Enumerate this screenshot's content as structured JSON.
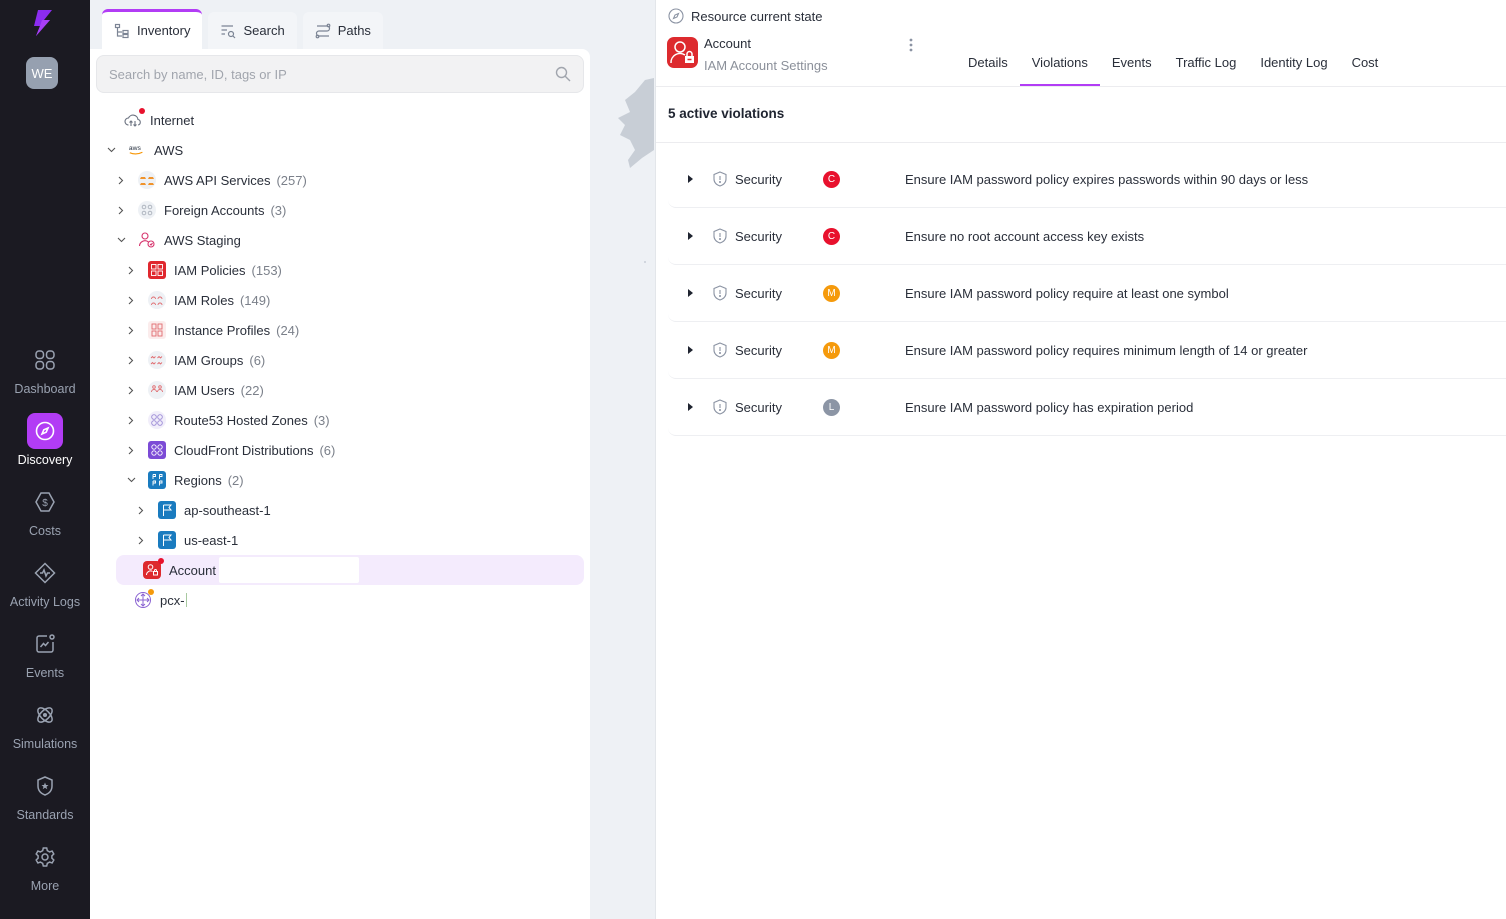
{
  "nav": {
    "avatar_initials": "WE",
    "items": [
      {
        "label": "Dashboard",
        "icon": "grid-icon",
        "active": false
      },
      {
        "label": "Discovery",
        "icon": "compass-icon",
        "active": true
      },
      {
        "label": "Costs",
        "icon": "dollar-hexagon-icon",
        "active": false
      },
      {
        "label": "Activity Logs",
        "icon": "activity-icon",
        "active": false
      },
      {
        "label": "Events",
        "icon": "chart-notification-icon",
        "active": false
      },
      {
        "label": "Simulations",
        "icon": "atom-icon",
        "active": false
      },
      {
        "label": "Standards",
        "icon": "shield-star-icon",
        "active": false
      },
      {
        "label": "More",
        "icon": "gear-icon",
        "active": false
      }
    ],
    "accent": "#b23cf5"
  },
  "inventory": {
    "tabs": [
      {
        "label": "Inventory",
        "icon": "hierarchy-icon",
        "active": true
      },
      {
        "label": "Search",
        "icon": "search-list-icon",
        "active": false
      },
      {
        "label": "Paths",
        "icon": "paths-icon",
        "active": false
      }
    ],
    "search_placeholder": "Search by name, ID, tags or IP",
    "tree": [
      {
        "label": "Internet",
        "count": "",
        "icon": "cloud-internet-icon"
      },
      {
        "label": "AWS",
        "count": "",
        "icon": "aws-logo-icon"
      },
      {
        "label": "AWS API Services",
        "count": "(257)",
        "icon": "api-services-icon"
      },
      {
        "label": "Foreign Accounts",
        "count": "(3)",
        "icon": "foreign-accounts-icon"
      },
      {
        "label": "AWS Staging",
        "count": "",
        "icon": "account-icon"
      },
      {
        "label": "IAM Policies",
        "count": "(153)",
        "icon": "iam-policies-icon"
      },
      {
        "label": "IAM Roles",
        "count": "(149)",
        "icon": "iam-roles-icon"
      },
      {
        "label": "Instance Profiles",
        "count": "(24)",
        "icon": "instance-profiles-icon"
      },
      {
        "label": "IAM Groups",
        "count": "(6)",
        "icon": "iam-groups-icon"
      },
      {
        "label": "IAM Users",
        "count": "(22)",
        "icon": "iam-users-icon"
      },
      {
        "label": "Route53 Hosted Zones",
        "count": "(3)",
        "icon": "route53-icon"
      },
      {
        "label": "CloudFront Distributions",
        "count": "(6)",
        "icon": "cloudfront-icon"
      },
      {
        "label": "Regions",
        "count": "(2)",
        "icon": "regions-icon"
      },
      {
        "label": "ap-southeast-1",
        "count": "",
        "icon": "region-flag-icon"
      },
      {
        "label": "us-east-1",
        "count": "",
        "icon": "region-flag-icon"
      },
      {
        "label": "Account",
        "count": "",
        "icon": "iam-account-icon"
      },
      {
        "label": "pcx-",
        "count": "",
        "icon": "peering-icon"
      }
    ]
  },
  "detail": {
    "state_label": "Resource current state",
    "resource_name": "Account",
    "resource_type": "IAM Account Settings",
    "tabs": [
      {
        "label": "Details",
        "active": false
      },
      {
        "label": "Violations",
        "active": true
      },
      {
        "label": "Events",
        "active": false
      },
      {
        "label": "Traffic Log",
        "active": false
      },
      {
        "label": "Identity Log",
        "active": false
      },
      {
        "label": "Cost",
        "active": false
      }
    ],
    "violation_count_label": "5 active violations",
    "violations": [
      {
        "category": "Security",
        "severity": "C",
        "severity_color": "#e8112d",
        "text": "Ensure IAM password policy expires passwords within 90 days or less"
      },
      {
        "category": "Security",
        "severity": "C",
        "severity_color": "#e8112d",
        "text": "Ensure no root account access key exists"
      },
      {
        "category": "Security",
        "severity": "M",
        "severity_color": "#f59a0c",
        "text": "Ensure IAM password policy require at least one symbol"
      },
      {
        "category": "Security",
        "severity": "M",
        "severity_color": "#f59a0c",
        "text": "Ensure IAM password policy requires minimum length of 14 or greater"
      },
      {
        "category": "Security",
        "severity": "L",
        "severity_color": "#8c95a5",
        "text": "Ensure IAM password policy has expiration period"
      }
    ]
  }
}
